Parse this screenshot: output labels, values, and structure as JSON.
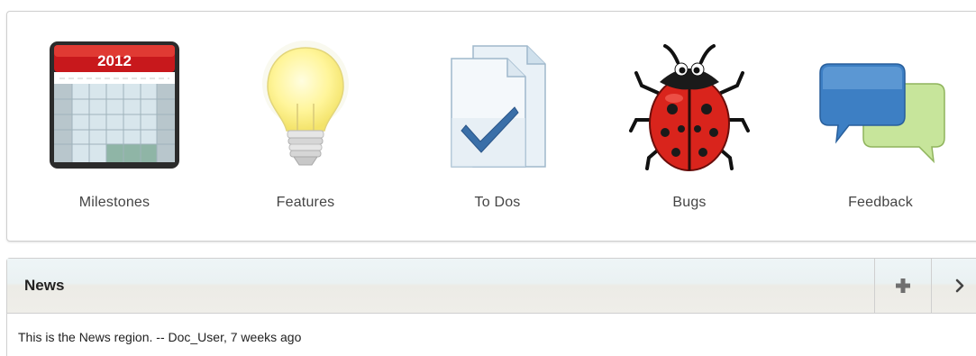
{
  "tiles": [
    {
      "label": "Milestones",
      "icon": "calendar-icon"
    },
    {
      "label": "Features",
      "icon": "lightbulb-icon"
    },
    {
      "label": "To Dos",
      "icon": "checked-document-icon"
    },
    {
      "label": "Bugs",
      "icon": "ladybug-icon"
    },
    {
      "label": "Feedback",
      "icon": "speech-bubbles-icon"
    }
  ],
  "calendar": {
    "year": "2012"
  },
  "news": {
    "title": "News",
    "add_icon": "plus-icon",
    "next_icon": "chevron-right-icon",
    "body": "This is the News region. -- Doc_User, 7 weeks ago"
  },
  "colors": {
    "calendar_red": "#c8181c",
    "bulb_yellow": "#fff59a",
    "check_blue": "#3a6fa8",
    "ladybug_red": "#d9241c",
    "bubble_blue": "#3d7fc4",
    "bubble_green": "#c7e59b"
  }
}
